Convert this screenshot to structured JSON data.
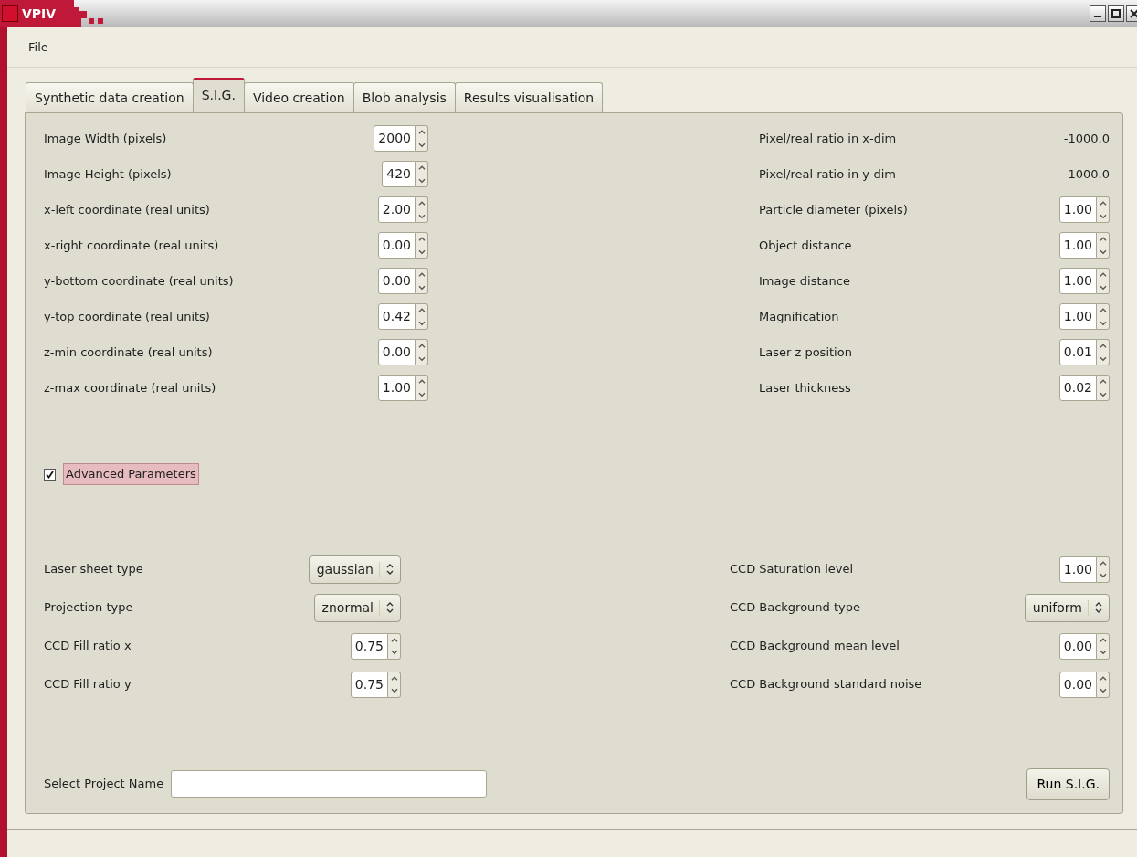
{
  "window": {
    "title": "VPIV"
  },
  "menu": [
    {
      "label": "File"
    }
  ],
  "tabs": [
    {
      "label": "Synthetic data creation",
      "selected": false
    },
    {
      "label": "S.I.G.",
      "selected": true
    },
    {
      "label": "Video creation",
      "selected": false
    },
    {
      "label": "Blob analysis",
      "selected": false
    },
    {
      "label": "Results visualisation",
      "selected": false
    }
  ],
  "left_fields": [
    {
      "label": "Image Width (pixels)",
      "kind": "spin",
      "value": "2000"
    },
    {
      "label": "Image Height (pixels)",
      "kind": "spin",
      "value": "420"
    },
    {
      "label": "x-left coordinate (real units)",
      "kind": "spin",
      "value": "2.00"
    },
    {
      "label": "x-right coordinate (real units)",
      "kind": "spin",
      "value": "0.00"
    },
    {
      "label": "y-bottom coordinate (real units)",
      "kind": "spin",
      "value": "0.00"
    },
    {
      "label": "y-top coordinate (real units)",
      "kind": "spin",
      "value": "0.42"
    },
    {
      "label": "z-min coordinate (real units)",
      "kind": "spin",
      "value": "0.00"
    },
    {
      "label": "z-max coordinate (real units)",
      "kind": "spin",
      "value": "1.00"
    }
  ],
  "right_fields": [
    {
      "label": "Pixel/real ratio in x-dim",
      "kind": "readout",
      "value": "-1000.0"
    },
    {
      "label": "Pixel/real ratio in y-dim",
      "kind": "readout",
      "value": "1000.0"
    },
    {
      "label": "Particle diameter (pixels)",
      "kind": "spin",
      "value": "1.00"
    },
    {
      "label": "Object distance",
      "kind": "spin",
      "value": "1.00"
    },
    {
      "label": "Image distance",
      "kind": "spin",
      "value": "1.00"
    },
    {
      "label": "Magnification",
      "kind": "spin",
      "value": "1.00"
    },
    {
      "label": "Laser z position",
      "kind": "spin",
      "value": "0.01"
    },
    {
      "label": "Laser thickness",
      "kind": "spin",
      "value": "0.02"
    }
  ],
  "advanced_toggle": {
    "label": "Advanced Parameters",
    "checked": true
  },
  "advanced_left": [
    {
      "label": "Laser sheet type",
      "kind": "combo",
      "value": "gaussian"
    },
    {
      "label": "Projection type",
      "kind": "combo",
      "value": "znormal"
    },
    {
      "label": "CCD Fill ratio x",
      "kind": "spin",
      "value": "0.75"
    },
    {
      "label": "CCD Fill ratio y",
      "kind": "spin",
      "value": "0.75"
    }
  ],
  "advanced_right": [
    {
      "label": "CCD Saturation level",
      "kind": "spin",
      "value": "1.00"
    },
    {
      "label": "CCD Background type",
      "kind": "combo",
      "value": "uniform"
    },
    {
      "label": "CCD Background mean level",
      "kind": "spin",
      "value": "0.00"
    },
    {
      "label": "CCD Background standard noise",
      "kind": "spin",
      "value": "0.00"
    }
  ],
  "project": {
    "label": "Select Project Name"
  },
  "run_button": {
    "label": "Run S.I.G."
  }
}
